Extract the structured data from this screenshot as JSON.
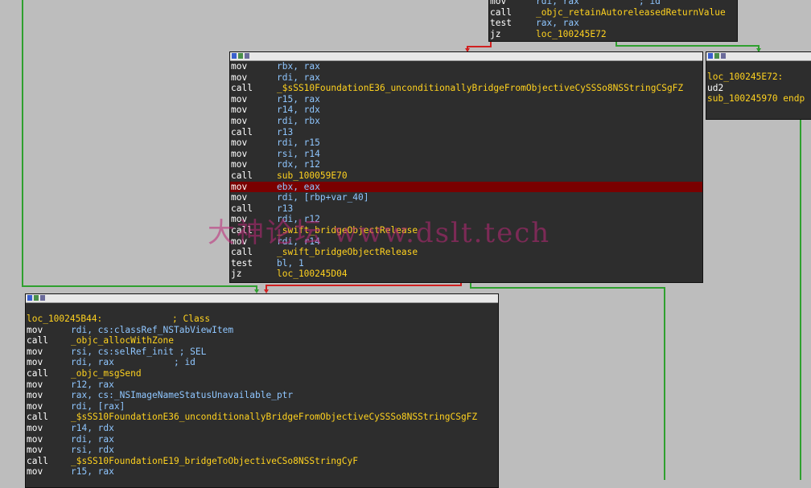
{
  "top_block": {
    "rows": [
      {
        "op": "mov",
        "args": "rdi, rax           ; id"
      },
      {
        "op": "call",
        "args": "_objc_retainAutoreleasedReturnValue"
      },
      {
        "op": "test",
        "args": "rax, rax"
      },
      {
        "op": "jz",
        "args": "loc_100245E72"
      }
    ]
  },
  "right_block": {
    "label": "loc_100245E72:",
    "rows": [
      {
        "op": "ud2",
        "args": ""
      },
      {
        "op": "sub_100245970 endp",
        "args": ""
      }
    ]
  },
  "middle_block": {
    "rows": [
      {
        "op": "mov",
        "args": "rbx, rax"
      },
      {
        "op": "mov",
        "args": "rdi, rax"
      },
      {
        "op": "call",
        "args": "_$sSS10FoundationE36_unconditionallyBridgeFromObjectiveCySSSo8NSStringCSgFZ"
      },
      {
        "op": "mov",
        "args": "r15, rax"
      },
      {
        "op": "mov",
        "args": "r14, rdx"
      },
      {
        "op": "mov",
        "args": "rdi, rbx"
      },
      {
        "op": "call",
        "args": "r13"
      },
      {
        "op": "mov",
        "args": "rdi, r15"
      },
      {
        "op": "mov",
        "args": "rsi, r14"
      },
      {
        "op": "mov",
        "args": "rdx, r12"
      },
      {
        "op": "call",
        "args": "sub_100059E70"
      },
      {
        "op": "mov",
        "args": "ebx, eax"
      },
      {
        "op": "mov",
        "args": "rdi, [rbp+var_40]"
      },
      {
        "op": "call",
        "args": "r13"
      },
      {
        "op": "mov",
        "args": "rdi, r12"
      },
      {
        "op": "call",
        "args": "_swift_bridgeObjectRelease"
      },
      {
        "op": "mov",
        "args": "rdi, r14"
      },
      {
        "op": "call",
        "args": "_swift_bridgeObjectRelease"
      },
      {
        "op": "test",
        "args": "bl, 1"
      },
      {
        "op": "jz",
        "args": "loc_100245D04"
      }
    ]
  },
  "bottom_block": {
    "label": "loc_100245B44:",
    "label_comment": "; Class",
    "rows": [
      {
        "op": "mov",
        "args": "rdi, cs:classRef_NSTabViewItem"
      },
      {
        "op": "call",
        "args": "_objc_allocWithZone"
      },
      {
        "op": "mov",
        "args": "rsi, cs:selRef_init ; SEL"
      },
      {
        "op": "mov",
        "args": "rdi, rax           ; id"
      },
      {
        "op": "call",
        "args": "_objc_msgSend"
      },
      {
        "op": "mov",
        "args": "r12, rax"
      },
      {
        "op": "mov",
        "args": "rax, cs:_NSImageNameStatusUnavailable_ptr"
      },
      {
        "op": "mov",
        "args": "rdi, [rax]"
      },
      {
        "op": "call",
        "args": "_$sSS10FoundationE36_unconditionallyBridgeFromObjectiveCySSSo8NSStringCSgFZ"
      },
      {
        "op": "mov",
        "args": "r14, rdx"
      },
      {
        "op": "mov",
        "args": "rdi, rax"
      },
      {
        "op": "mov",
        "args": "rsi, rdx"
      },
      {
        "op": "call",
        "args": "_$sSS10FoundationE19_bridgeToObjectiveCSo8NSStringCyF"
      },
      {
        "op": "mov",
        "args": "r15, rax"
      }
    ]
  },
  "watermark": "大神论坛 www.dslt.tech",
  "colors": {
    "background": "#bdbdbd",
    "block_bg": "#2d2d2d",
    "highlight": "#7a0000",
    "edge_green": "#2fa02f",
    "edge_red": "#d02020",
    "symbol": "#ffd21f"
  }
}
